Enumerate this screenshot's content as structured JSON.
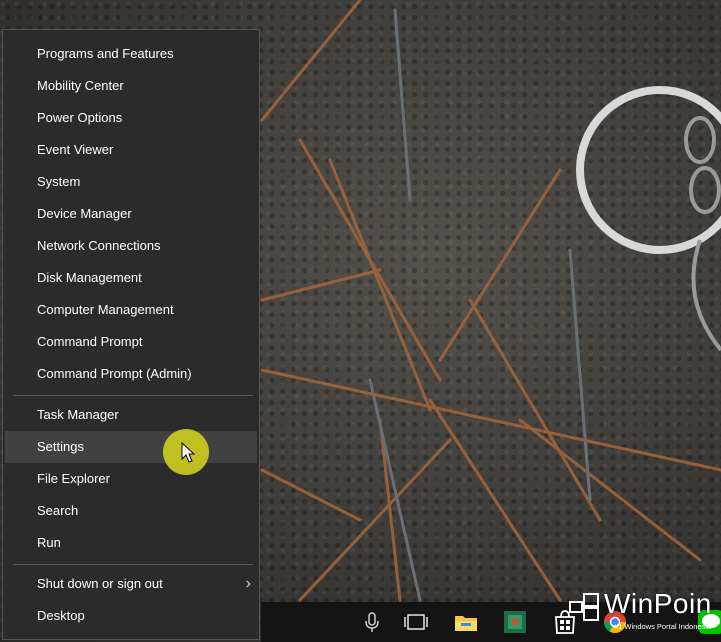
{
  "menu": {
    "group1": [
      "Programs and Features",
      "Mobility Center",
      "Power Options",
      "Event Viewer",
      "System",
      "Device Manager",
      "Network Connections",
      "Disk Management",
      "Computer Management",
      "Command Prompt",
      "Command Prompt (Admin)"
    ],
    "group2": [
      "Task Manager",
      "Settings",
      "File Explorer",
      "Search",
      "Run"
    ],
    "group3": [
      "Shut down or sign out",
      "Desktop"
    ],
    "hovered_item": "Settings",
    "submenu_item": "Shut down or sign out"
  },
  "taskbar": {
    "icons": [
      "microphone-icon",
      "task-view-icon",
      "file-explorer-icon",
      "app-icon",
      "store-icon",
      "chrome-icon",
      "line-app-icon"
    ]
  },
  "watermark": {
    "title": "WinPoin",
    "subtitle": "#1 Windows Portal Indonesia"
  },
  "colors": {
    "menu_bg": "#2b2b2b",
    "menu_hover": "#414141",
    "menu_text": "#ffffff",
    "taskbar_bg": "#141414",
    "cursor_halo": "#d2d21e"
  }
}
